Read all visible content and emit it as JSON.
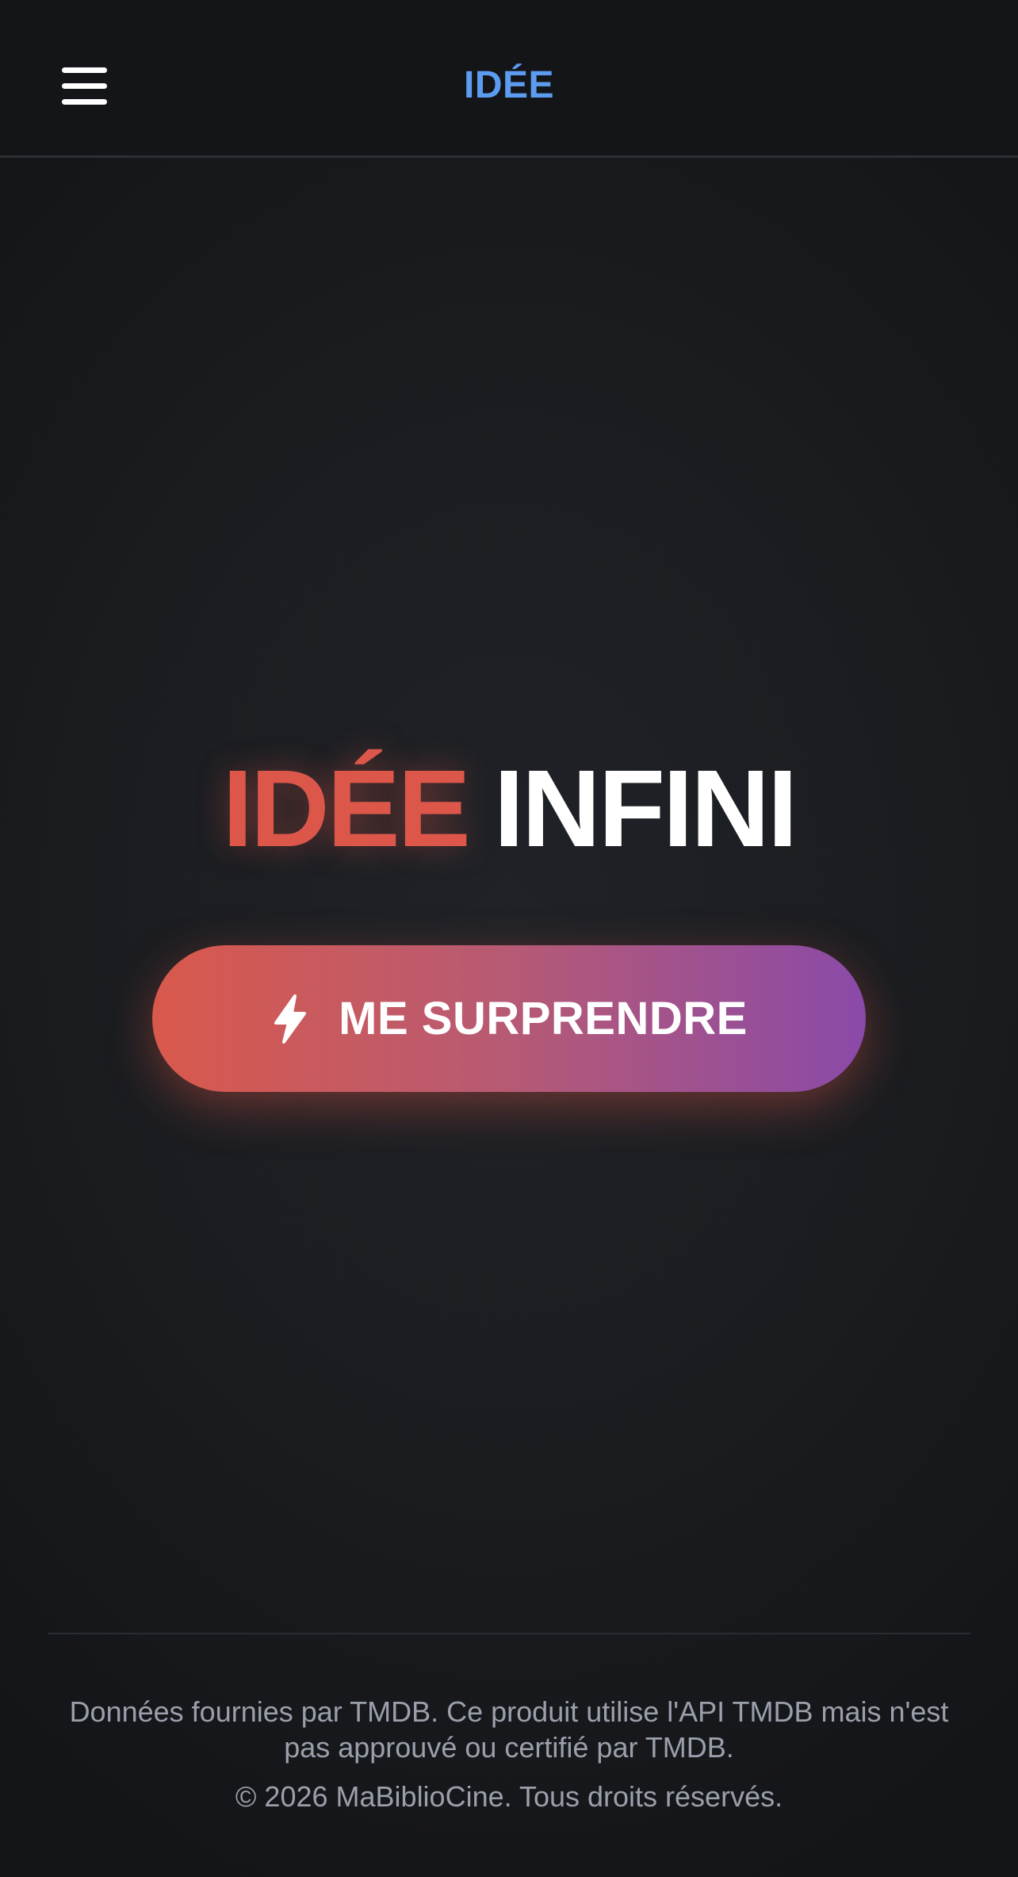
{
  "header": {
    "menu_icon": "hamburger-menu-icon",
    "title": "IDÉE"
  },
  "hero": {
    "title_part1": "IDÉE",
    "title_part2": "INFINI",
    "title_part1_color": "#dc574a"
  },
  "action": {
    "icon": "lightning-bolt-icon",
    "label": "ME SURPRENDRE",
    "gradient_start": "#d9594c",
    "gradient_end": "#8a4aa8"
  },
  "footer": {
    "notice": "Données fournies par TMDB. Ce produit utilise l'API TMDB mais n'est pas approuvé ou certifié par TMDB.",
    "copyright": "© 2026 MaBiblioCine. Tous droits réservés."
  },
  "colors": {
    "accent_blue": "#5b9cf0",
    "background": "#1a1c20"
  }
}
